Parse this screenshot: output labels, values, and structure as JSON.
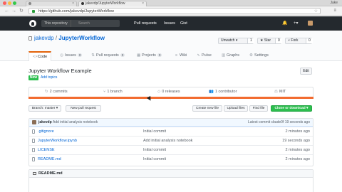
{
  "browser": {
    "tabs": [
      {
        "title": "jakevdp/JupyterWorkflow"
      },
      {
        "title": ""
      }
    ],
    "user": "Jake",
    "url": "https://github.com/jakevdp/JupyterWorkflow"
  },
  "gh_header": {
    "search_scope": "This repository",
    "search_placeholder": "Search",
    "nav": [
      "Pull requests",
      "Issues",
      "Gist"
    ],
    "bell": "🔔",
    "plus": "+▾"
  },
  "repo": {
    "owner": "jakevdp",
    "separator": "/",
    "name": "JupyterWorkflow",
    "watch": {
      "label": "Unwatch ▾",
      "count": "1"
    },
    "star": {
      "label": "★ Star",
      "count": "0"
    },
    "fork": {
      "label": "Fork",
      "count": "0"
    },
    "tabs": [
      {
        "label": "Code",
        "icon": "<>",
        "count": ""
      },
      {
        "label": "Issues",
        "icon": "◎",
        "count": "0"
      },
      {
        "label": "Pull requests",
        "icon": "⇅",
        "count": "0"
      },
      {
        "label": "Projects",
        "icon": "▦",
        "count": "0"
      },
      {
        "label": "Wiki",
        "icon": "≡",
        "count": ""
      },
      {
        "label": "Pulse",
        "icon": "∿",
        "count": ""
      },
      {
        "label": "Graphs",
        "icon": "▥",
        "count": ""
      },
      {
        "label": "Settings",
        "icon": "⚙",
        "count": ""
      }
    ],
    "description": "Jupyter Workflow Example",
    "edit_label": "Edit",
    "new_badge": "New",
    "add_topics": "Add topics"
  },
  "summary": [
    {
      "icon": "↻",
      "text": "2 commits"
    },
    {
      "icon": "⑂",
      "text": "1 branch"
    },
    {
      "icon": "◇",
      "text": "0 releases"
    },
    {
      "icon": "👥",
      "text": "1 contributor"
    },
    {
      "icon": "⚖",
      "text": "MIT"
    }
  ],
  "toolbar": {
    "branch": "Branch: master ▾",
    "new_pr": "New pull request",
    "create_file": "Create new file",
    "upload": "Upload files",
    "find": "Find file",
    "clone": "Clone or download ▾"
  },
  "commit": {
    "author": "jakevdp",
    "message": "Add initial analysis notebook",
    "latest": "Latest commit cbade0f 19 seconds ago"
  },
  "files": [
    {
      "name": ".gitignore",
      "message": "Initial commit",
      "age": "2 minutes ago"
    },
    {
      "name": "JupyterWorkflow.ipynb",
      "message": "Add initial analysis notebook",
      "age": "19 seconds ago"
    },
    {
      "name": "LICENSE",
      "message": "Initial commit",
      "age": "2 minutes ago"
    },
    {
      "name": "README.md",
      "message": "Initial commit",
      "age": "2 minutes ago"
    }
  ],
  "readme": {
    "title": "README.md"
  },
  "colors": {
    "accent_orange": "#f26b2f",
    "header_dark": "#24292e",
    "link_blue": "#0366d6",
    "green": "#2cbe4e"
  }
}
